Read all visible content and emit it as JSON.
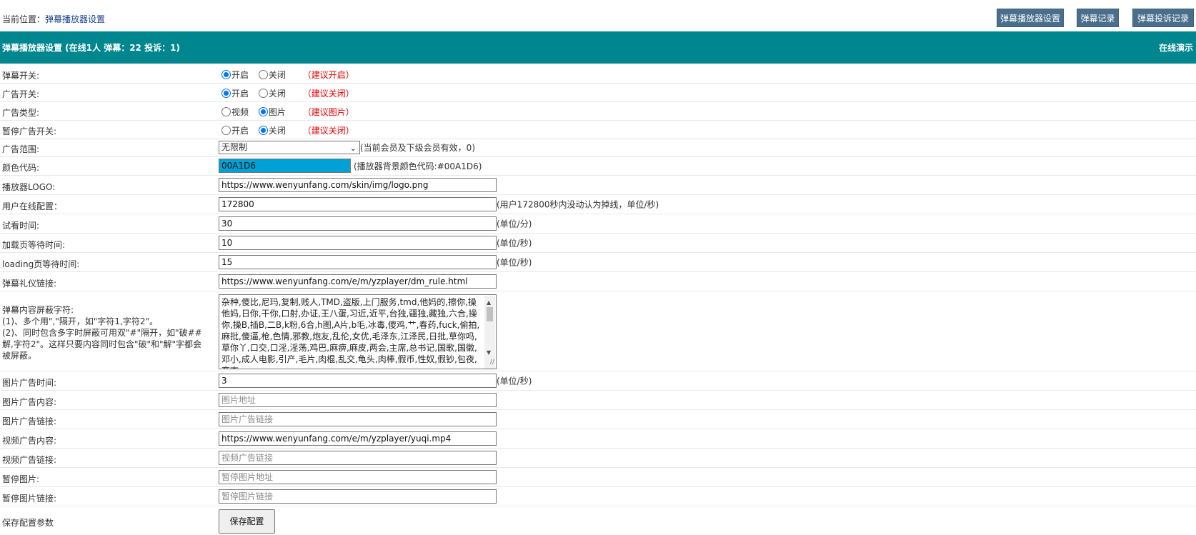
{
  "breadcrumb": {
    "prefix": "当前位置：",
    "current": "弹幕播放器设置"
  },
  "top_buttons": [
    "弹幕播放器设置",
    "弹幕记录",
    "弹幕投诉记录"
  ],
  "header": {
    "title": "弹幕播放器设置 (在线1人 弹幕：22 投诉：1)",
    "demo_link": "在线演示"
  },
  "radio_rows": [
    {
      "label": "弹幕开关:",
      "options": [
        "开启",
        "关闭"
      ],
      "selected": 0,
      "hint": "（建议开启）"
    },
    {
      "label": "广告开关:",
      "options": [
        "开启",
        "关闭"
      ],
      "selected": 0,
      "hint": "（建议关闭）"
    },
    {
      "label": "广告类型:",
      "options": [
        "视频",
        "图片"
      ],
      "selected": 1,
      "hint": "（建议图片）"
    },
    {
      "label": "暂停广告开关:",
      "options": [
        "开启",
        "关闭"
      ],
      "selected": 1,
      "hint": "（建议关闭）"
    }
  ],
  "ad_scope": {
    "label": "广告范围:",
    "selected": "无限制",
    "note": "(当前会员及下级会员有效，0)"
  },
  "color_code": {
    "label": "颜色代码:",
    "value": "00A1D6",
    "note": "(播放器背景颜色代码:#00A1D6)"
  },
  "fields": [
    {
      "label": "播放器LOGO:",
      "value": "https://www.wenyunfang.com/skin/img/logo.png",
      "placeholder": "",
      "unit": ""
    },
    {
      "label": "用户在线配置：",
      "value": "172800",
      "placeholder": "",
      "unit": "(用户172800秒内没动认为掉线，单位/秒)"
    },
    {
      "label": "试看时间:",
      "value": "30",
      "placeholder": "",
      "unit": "(单位/分)"
    },
    {
      "label": "加载页等待时间:",
      "value": "10",
      "placeholder": "",
      "unit": "(单位/秒)"
    },
    {
      "label": "loading页等待时间:",
      "value": "15",
      "placeholder": "",
      "unit": "(单位/秒)"
    },
    {
      "label": "弹幕礼仪链接:",
      "value": "https://www.wenyunfang.com/e/m/yzplayer/dm_rule.html",
      "placeholder": "",
      "unit": ""
    }
  ],
  "blocked_words": {
    "label_title": "弹幕内容屏蔽字符:",
    "label_lines": [
      "(1)、多个用\",\"隔开，如\"字符1,字符2\"。",
      "(2)、同时包含多字时屏蔽可用双\"#\"隔开，如\"破##解,字符2\"。这样只要内容同时包含\"破\"和\"解\"字都会被屏蔽。"
    ],
    "value": "杂种,傻比,尼玛,复制,贱人,TMD,盗版,上门服务,tmd,他妈的,擦你,操他妈,日你,干你,口射,办证,王八蛋,习近,近平,台独,疆独,藏独,六合,操你,操B,插B,二B,k粉,6合,h图,A片,b毛,冰毒,傻鸡,艹,春药,fuck,偷拍,麻批,傻逼,枪,色情,邪教,炮友,乱伦,女优,毛泽东,江泽民,日批,草你吗,草你丫,口交,口淫,淫荡,鸡巴,麻痹,麻皮,两会,主席,总书记,国歌,国徽,邓小,成人电影,引产,毛片,肉棍,乱交,龟头,肉棒,假币,性奴,假钞,包夜,变态,"
  },
  "fields_after": [
    {
      "label": "图片广告时间:",
      "value": "3",
      "placeholder": "",
      "unit": "(单位/秒)"
    },
    {
      "label": "图片广告内容:",
      "value": "",
      "placeholder": "图片地址",
      "unit": ""
    },
    {
      "label": "图片广告链接:",
      "value": "",
      "placeholder": "图片广告链接",
      "unit": ""
    },
    {
      "label": "视频广告内容:",
      "value": "https://www.wenyunfang.com/e/m/yzplayer/yuqi.mp4",
      "placeholder": "",
      "unit": ""
    },
    {
      "label": "视频广告链接:",
      "value": "",
      "placeholder": "视频广告链接",
      "unit": ""
    },
    {
      "label": "暂停图片:",
      "value": "",
      "placeholder": "暂停图片地址",
      "unit": ""
    },
    {
      "label": "暂停图片链接:",
      "value": "",
      "placeholder": "暂停图片链接",
      "unit": ""
    }
  ],
  "save": {
    "label": "保存配置参数",
    "button": "保存配置"
  },
  "colors": {
    "header_bg": "#00868f",
    "top_button_bg": "#4a6f8c",
    "hint_red": "#e60000",
    "color_swatch": "#00A1D6",
    "radio_blue": "#0075ff"
  }
}
